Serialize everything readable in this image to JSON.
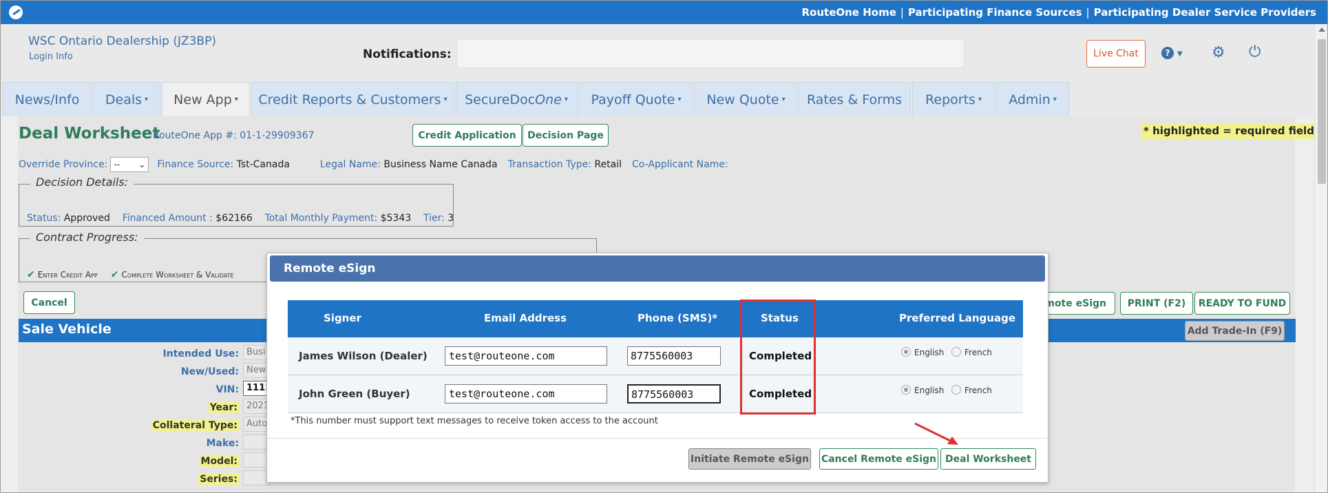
{
  "topbar": {
    "links": [
      "RouteOne Home",
      "Participating Finance Sources",
      "Participating Dealer Service Providers"
    ],
    "separator": "|"
  },
  "header": {
    "dealer_name": "WSC Ontario Dealership (JZ3BP)",
    "login_info": "Login Info",
    "notifications_label": "Notifications:",
    "live_chat": "Live Chat",
    "help_glyph": "?"
  },
  "nav": {
    "tabs": [
      {
        "label": "News/Info",
        "caret": ""
      },
      {
        "label": "Deals",
        "caret": "▾"
      },
      {
        "label": "New App",
        "caret": "▾"
      },
      {
        "label": "Credit Reports & Customers",
        "caret": "▾"
      },
      {
        "label": "SecureDoc",
        "label_italic": "One",
        "caret": "▾"
      },
      {
        "label": "Payoff Quote",
        "caret": "▾"
      },
      {
        "label": "New Quote",
        "caret": "▾"
      },
      {
        "label": "Rates & Forms",
        "caret": ""
      },
      {
        "label": "Reports",
        "caret": "▾"
      },
      {
        "label": "Admin",
        "caret": "▾"
      }
    ]
  },
  "worksheet": {
    "title": "Deal Worksheet",
    "app_number": "RouteOne App #: 01-1-29909367",
    "credit_application_btn": "Credit Application",
    "decision_page_btn": "Decision Page",
    "required_note": "* highlighted = required field",
    "override_province_label": "Override Province:",
    "override_province_value": "--",
    "finance_source_label": "Finance Source:",
    "finance_source_value": "Tst-Canada",
    "legal_name_label": "Legal Name:",
    "legal_name_value": "Business Name Canada",
    "transaction_type_label": "Transaction Type:",
    "transaction_type_value": "Retail",
    "co_applicant_label": "Co-Applicant Name:",
    "decision_details_legend": "Decision Details:",
    "status_label": "Status:",
    "status_value": "Approved",
    "financed_amount_label": "Financed Amount :",
    "financed_amount_value": "$62166",
    "total_monthly_label": "Total Monthly Payment:",
    "total_monthly_value": "$5343",
    "tier_label": "Tier:",
    "tier_value": "3",
    "contract_progress_legend": "Contract Progress:",
    "progress_steps": [
      "Enter Credit App",
      "Complete Worksheet & Validate"
    ],
    "cancel_btn": "Cancel",
    "remote_esign_btn_partial": "emote eSign",
    "print_btn": "PRINT (F2)",
    "ready_to_fund_btn": "READY TO FUND",
    "sale_vehicle_title": "Sale Vehicle",
    "add_trade_btn": "Add Trade-In (F9)",
    "form_labels": [
      {
        "label": "Intended Use:",
        "highlight": false,
        "value": "Busi"
      },
      {
        "label": "New/Used:",
        "highlight": false,
        "value": "New"
      },
      {
        "label": "VIN:",
        "highlight": false,
        "value": "1111"
      },
      {
        "label": "Year:",
        "highlight": true,
        "value": "2021"
      },
      {
        "label": "Collateral Type:",
        "highlight": true,
        "value": "Auto"
      },
      {
        "label": "Make:",
        "highlight": false,
        "value": ""
      },
      {
        "label": "Model:",
        "highlight": true,
        "value": ""
      },
      {
        "label": "Series:",
        "highlight": true,
        "value": ""
      }
    ]
  },
  "modal": {
    "title": "Remote eSign",
    "columns": [
      "Signer",
      "Email Address",
      "Phone (SMS)*",
      "Status",
      "Preferred Language"
    ],
    "signers": [
      {
        "name": "James Wilson (Dealer)",
        "email": "test@routeone.com",
        "phone": "8775560003",
        "status": "Completed",
        "lang_english": "English",
        "lang_french": "French"
      },
      {
        "name": "John Green (Buyer)",
        "email": "test@routeone.com",
        "phone": "8775560003",
        "status": "Completed",
        "lang_english": "English",
        "lang_french": "French"
      }
    ],
    "footnote": "*This number must support text messages to receive token access to the account",
    "initiate_btn": "Initiate Remote eSign",
    "cancel_btn": "Cancel Remote eSign",
    "deal_worksheet_btn": "Deal Worksheet"
  },
  "colors": {
    "brand_blue": "#1f74c6",
    "modal_header": "#4a72ad",
    "accent_green": "#2e7d5b",
    "highlight_yellow": "#f2f28b",
    "annotation_red": "#e03030"
  }
}
